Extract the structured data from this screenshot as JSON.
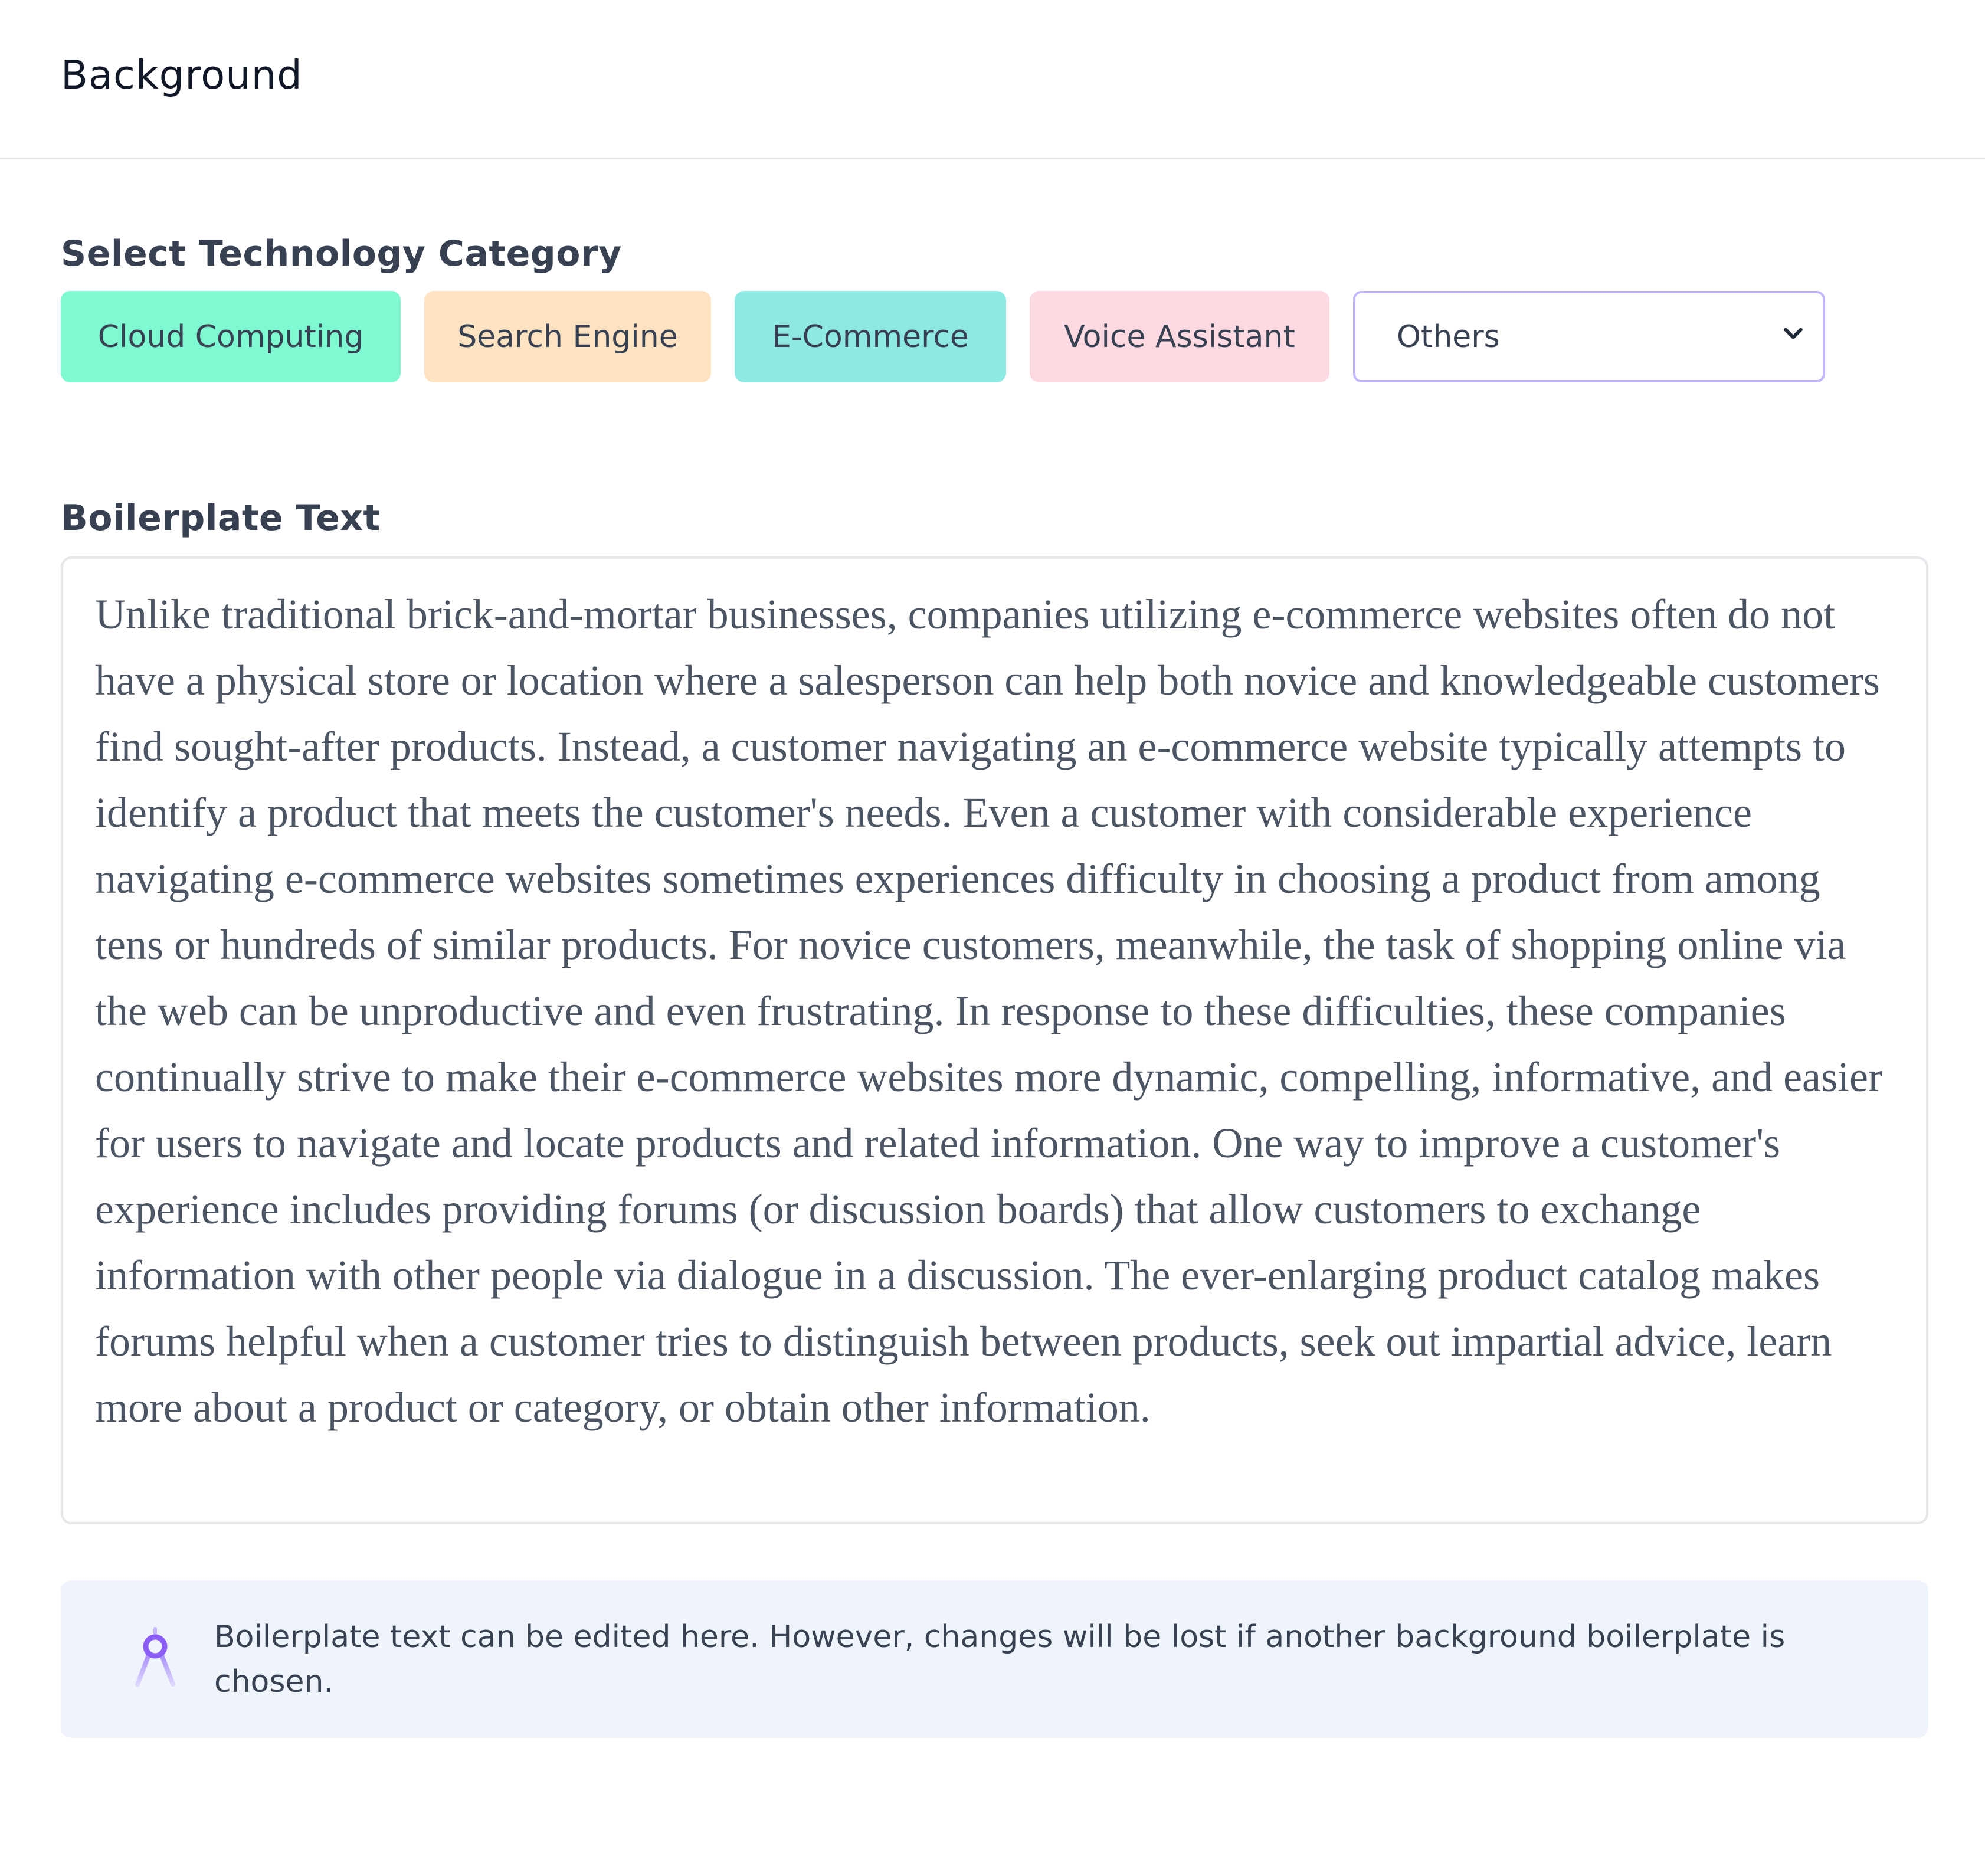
{
  "header": {
    "title": "Background"
  },
  "category": {
    "label": "Select Technology Category",
    "chips": [
      {
        "label": "Cloud Computing",
        "color": "#7ef9d2"
      },
      {
        "label": "Search Engine",
        "color": "#fee3c3"
      },
      {
        "label": "E-Commerce",
        "color": "#8ee9e5"
      },
      {
        "label": "Voice Assistant",
        "color": "#fdd9e2"
      }
    ],
    "select": {
      "value": "Others",
      "icon": "chevron-down-icon"
    }
  },
  "boilerplate": {
    "label": "Boilerplate Text",
    "text": "Unlike traditional brick-and-mortar businesses, companies utilizing e-commerce websites often do not have a physical store or location where a salesperson can help both novice and knowledgeable customers find sought-after products. Instead, a customer navigating an e-commerce website typically attempts to identify a product that meets the customer's needs. Even a customer with considerable experience navigating e-commerce websites sometimes experiences difficulty in choosing a product from among tens or hundreds of similar products. For novice customers, meanwhile, the task of shopping online via the web can be unproductive and even frustrating. In response to these difficulties, these companies continually strive to make their e-commerce websites more dynamic, compelling, informative, and easier for users to navigate and locate products and related information. One way to improve a customer's experience includes providing forums (or discussion boards) that allow customers to exchange information with other people via dialogue in a discussion. The ever-enlarging product catalog makes forums helpful when a customer tries to distinguish between products, seek out impartial advice, learn more about a product or category, or obtain other information."
  },
  "notice": {
    "icon": "compass-icon",
    "text": "Boilerplate text can be edited here. However, changes will be lost if another background boilerplate is chosen.",
    "accent": "#8b5cf6"
  }
}
